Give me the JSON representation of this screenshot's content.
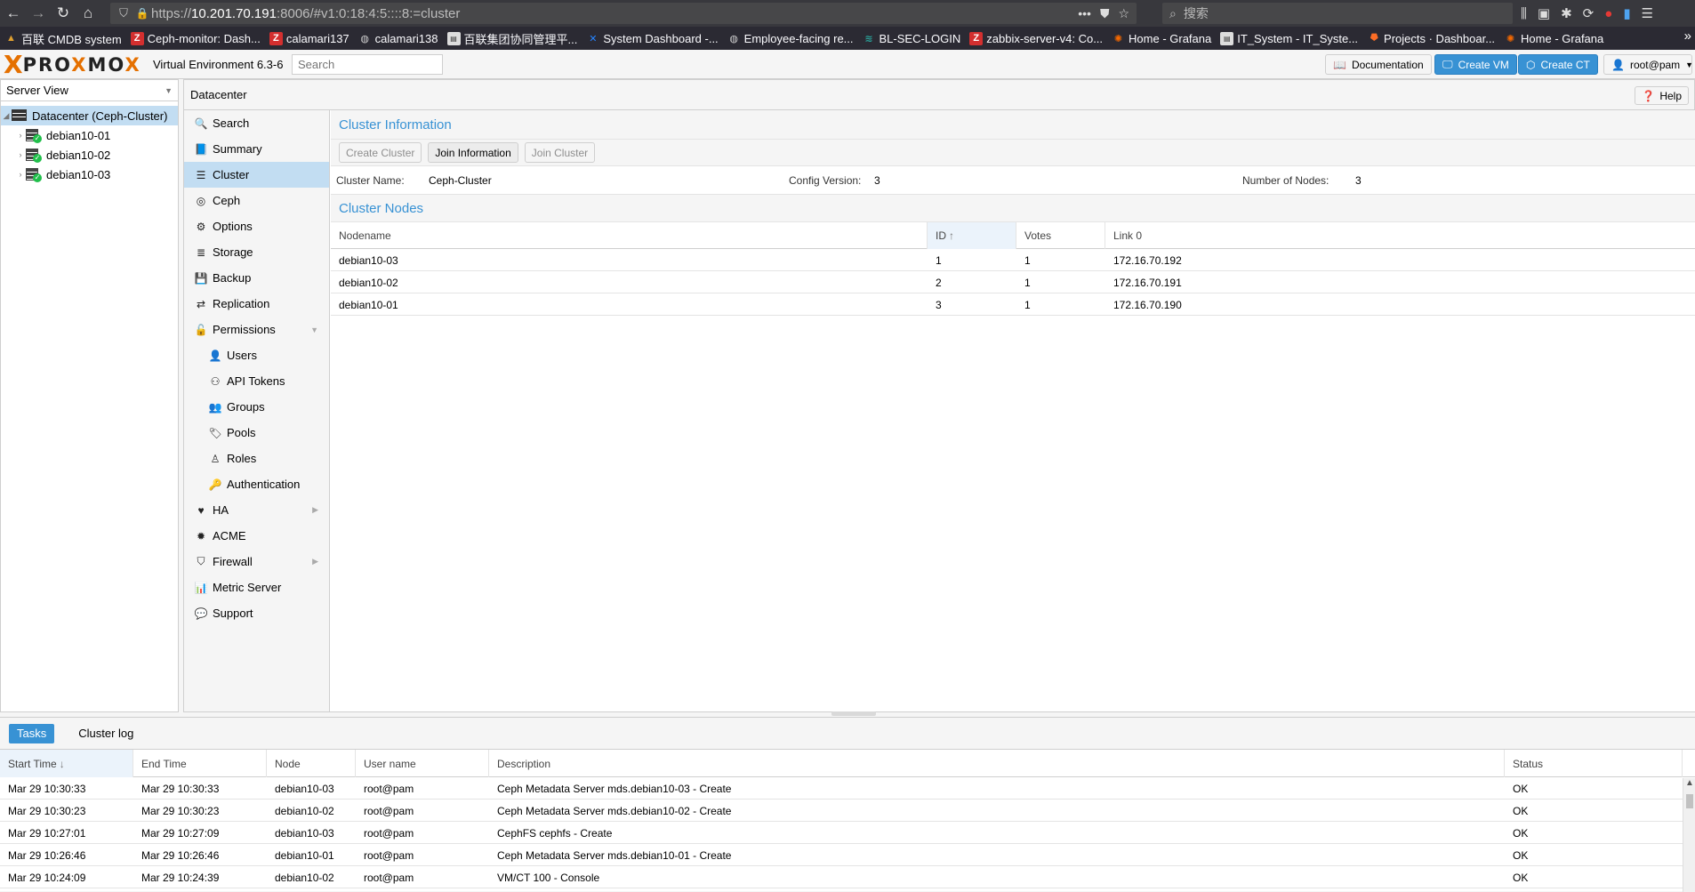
{
  "browser": {
    "url_scheme": "https://",
    "url_host": "10.201.70.191",
    "url_rest": ":8006/#v1:0:18:4:5::::8:=cluster",
    "search_placeholder": "搜索"
  },
  "bookmarks": [
    {
      "label": "百联 CMDB system",
      "icon": "cmdb-icon",
      "color": "#e0a030"
    },
    {
      "label": "Ceph-monitor: Dash...",
      "icon": "z-icon",
      "color": "#d32f2f"
    },
    {
      "label": "calamari137",
      "icon": "z-icon",
      "color": "#d32f2f"
    },
    {
      "label": "calamari138",
      "icon": "globe-icon",
      "color": "#cccccc"
    },
    {
      "label": "百联集团协同管理平...",
      "icon": "doc-icon",
      "color": "#dddddd"
    },
    {
      "label": "System Dashboard -...",
      "icon": "jira-icon",
      "color": "#2684ff"
    },
    {
      "label": "Employee-facing re...",
      "icon": "globe-icon",
      "color": "#cccccc"
    },
    {
      "label": "BL-SEC-LOGIN",
      "icon": "stack-icon",
      "color": "#2aa198"
    },
    {
      "label": "zabbix-server-v4: Co...",
      "icon": "z-icon",
      "color": "#d32f2f"
    },
    {
      "label": "Home - Grafana",
      "icon": "grafana-icon",
      "color": "#f46800"
    },
    {
      "label": "IT_System - IT_Syste...",
      "icon": "doc-icon",
      "color": "#dddddd"
    },
    {
      "label": "Projects · Dashboar...",
      "icon": "gitlab-icon",
      "color": "#fc6d26"
    },
    {
      "label": "Home - Grafana",
      "icon": "grafana-icon",
      "color": "#f46800"
    }
  ],
  "header": {
    "logo_x": "X",
    "logo_pro": "PRO",
    "logo_x2": "X",
    "logo_mo": "MO",
    "logo_x3": "X",
    "version": "Virtual Environment 6.3-6",
    "search_placeholder": "Search",
    "documentation_label": "Documentation",
    "create_vm_label": "Create VM",
    "create_ct_label": "Create CT",
    "user_label": "root@pam"
  },
  "tree": {
    "view_label": "Server View",
    "datacenter_label": "Datacenter (Ceph-Cluster)",
    "nodes": [
      "debian10-01",
      "debian10-02",
      "debian10-03"
    ]
  },
  "content": {
    "title": "Datacenter",
    "help_label": "Help"
  },
  "menu": [
    {
      "label": "Search",
      "icon": "search-icon",
      "glyph": "🔍",
      "sub": false,
      "selected": false,
      "arrow": ""
    },
    {
      "label": "Summary",
      "icon": "book-icon",
      "glyph": "📘",
      "sub": false,
      "selected": false,
      "arrow": ""
    },
    {
      "label": "Cluster",
      "icon": "server-icon",
      "glyph": "☰",
      "sub": false,
      "selected": true,
      "arrow": ""
    },
    {
      "label": "Ceph",
      "icon": "ceph-icon",
      "glyph": "◎",
      "sub": false,
      "selected": false,
      "arrow": ""
    },
    {
      "label": "Options",
      "icon": "gear-icon",
      "glyph": "⚙",
      "sub": false,
      "selected": false,
      "arrow": ""
    },
    {
      "label": "Storage",
      "icon": "database-icon",
      "glyph": "≣",
      "sub": false,
      "selected": false,
      "arrow": ""
    },
    {
      "label": "Backup",
      "icon": "floppy-icon",
      "glyph": "💾",
      "sub": false,
      "selected": false,
      "arrow": ""
    },
    {
      "label": "Replication",
      "icon": "retweet-icon",
      "glyph": "⇄",
      "sub": false,
      "selected": false,
      "arrow": ""
    },
    {
      "label": "Permissions",
      "icon": "unlock-icon",
      "glyph": "🔓",
      "sub": false,
      "selected": false,
      "arrow": "▼"
    },
    {
      "label": "Users",
      "icon": "user-icon",
      "glyph": "👤",
      "sub": true,
      "selected": false,
      "arrow": ""
    },
    {
      "label": "API Tokens",
      "icon": "user-outline-icon",
      "glyph": "⚇",
      "sub": true,
      "selected": false,
      "arrow": ""
    },
    {
      "label": "Groups",
      "icon": "users-icon",
      "glyph": "👥",
      "sub": true,
      "selected": false,
      "arrow": ""
    },
    {
      "label": "Pools",
      "icon": "tags-icon",
      "glyph": "🏷",
      "sub": true,
      "selected": false,
      "arrow": ""
    },
    {
      "label": "Roles",
      "icon": "male-icon",
      "glyph": "♙",
      "sub": true,
      "selected": false,
      "arrow": ""
    },
    {
      "label": "Authentication",
      "icon": "key-icon",
      "glyph": "🔑",
      "sub": true,
      "selected": false,
      "arrow": ""
    },
    {
      "label": "HA",
      "icon": "heartbeat-icon",
      "glyph": "♥",
      "sub": false,
      "selected": false,
      "arrow": "▶"
    },
    {
      "label": "ACME",
      "icon": "certificate-icon",
      "glyph": "✹",
      "sub": false,
      "selected": false,
      "arrow": ""
    },
    {
      "label": "Firewall",
      "icon": "shield-icon",
      "glyph": "⛉",
      "sub": false,
      "selected": false,
      "arrow": "▶"
    },
    {
      "label": "Metric Server",
      "icon": "bar-chart-icon",
      "glyph": "📊",
      "sub": false,
      "selected": false,
      "arrow": ""
    },
    {
      "label": "Support",
      "icon": "comments-icon",
      "glyph": "💬",
      "sub": false,
      "selected": false,
      "arrow": ""
    }
  ],
  "cluster": {
    "info_title": "Cluster Information",
    "buttons": {
      "create": "Create Cluster",
      "join_info": "Join Information",
      "join": "Join Cluster"
    },
    "name_label": "Cluster Name:",
    "name_value": "Ceph-Cluster",
    "config_label": "Config Version:",
    "config_value": "3",
    "nodes_label": "Number of Nodes:",
    "nodes_value": "3",
    "nodes_title": "Cluster Nodes",
    "columns": {
      "nodename": "Nodename",
      "id": "ID",
      "votes": "Votes",
      "link0": "Link 0"
    },
    "rows": [
      {
        "nodename": "debian10-03",
        "id": "1",
        "votes": "1",
        "link0": "172.16.70.192"
      },
      {
        "nodename": "debian10-02",
        "id": "2",
        "votes": "1",
        "link0": "172.16.70.191"
      },
      {
        "nodename": "debian10-01",
        "id": "3",
        "votes": "1",
        "link0": "172.16.70.190"
      }
    ]
  },
  "tasks": {
    "tab_tasks": "Tasks",
    "tab_log": "Cluster log",
    "columns": {
      "start": "Start Time",
      "end": "End Time",
      "node": "Node",
      "user": "User name",
      "desc": "Description",
      "status": "Status"
    },
    "rows": [
      {
        "start": "Mar 29 10:30:33",
        "end": "Mar 29 10:30:33",
        "node": "debian10-03",
        "user": "root@pam",
        "desc": "Ceph Metadata Server mds.debian10-03 - Create",
        "status": "OK"
      },
      {
        "start": "Mar 29 10:30:23",
        "end": "Mar 29 10:30:23",
        "node": "debian10-02",
        "user": "root@pam",
        "desc": "Ceph Metadata Server mds.debian10-02 - Create",
        "status": "OK"
      },
      {
        "start": "Mar 29 10:27:01",
        "end": "Mar 29 10:27:09",
        "node": "debian10-03",
        "user": "root@pam",
        "desc": "CephFS cephfs - Create",
        "status": "OK"
      },
      {
        "start": "Mar 29 10:26:46",
        "end": "Mar 29 10:26:46",
        "node": "debian10-01",
        "user": "root@pam",
        "desc": "Ceph Metadata Server mds.debian10-01 - Create",
        "status": "OK"
      },
      {
        "start": "Mar 29 10:24:09",
        "end": "Mar 29 10:24:39",
        "node": "debian10-02",
        "user": "root@pam",
        "desc": "VM/CT 100 - Console",
        "status": "OK"
      }
    ]
  },
  "colors": {
    "accent": "#3892d4",
    "selected": "#c2ddf2",
    "logo_orange": "#e57000",
    "ok_green": "#21bf4b"
  }
}
